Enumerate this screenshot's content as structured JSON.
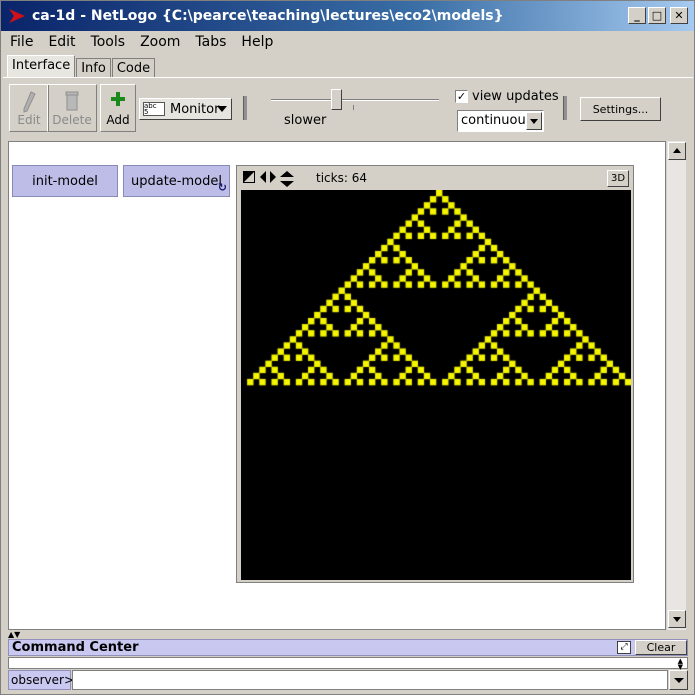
{
  "window": {
    "title": "ca-1d - NetLogo {C:\\pearce\\teaching\\lectures\\eco2\\models}",
    "controls": [
      "minimize",
      "maximize",
      "close"
    ]
  },
  "menu": [
    "File",
    "Edit",
    "Tools",
    "Zoom",
    "Tabs",
    "Help"
  ],
  "tabs": [
    {
      "label": "Interface",
      "active": true
    },
    {
      "label": "Info",
      "active": false
    },
    {
      "label": "Code",
      "active": false
    }
  ],
  "toolbar": {
    "edit_label": "Edit",
    "delete_label": "Delete",
    "add_label": "Add",
    "widget_type": "Monitor",
    "speed_label": "slower",
    "speed_position": 0.4,
    "view_updates_label": "view updates",
    "view_updates_checked": true,
    "update_mode": "continuous",
    "settings_label": "Settings..."
  },
  "widgets": {
    "init_button": "init-model",
    "update_button": "update-model",
    "update_forever": true
  },
  "view": {
    "ticks_text": "ticks: 64",
    "btn_3d": "3D",
    "patch_color": "#f5f500",
    "background": "#000000",
    "rule": 90,
    "rows": 64,
    "cols": 64
  },
  "command_center": {
    "title": "Command Center",
    "clear_label": "Clear",
    "agent": "observer>",
    "input_value": ""
  }
}
